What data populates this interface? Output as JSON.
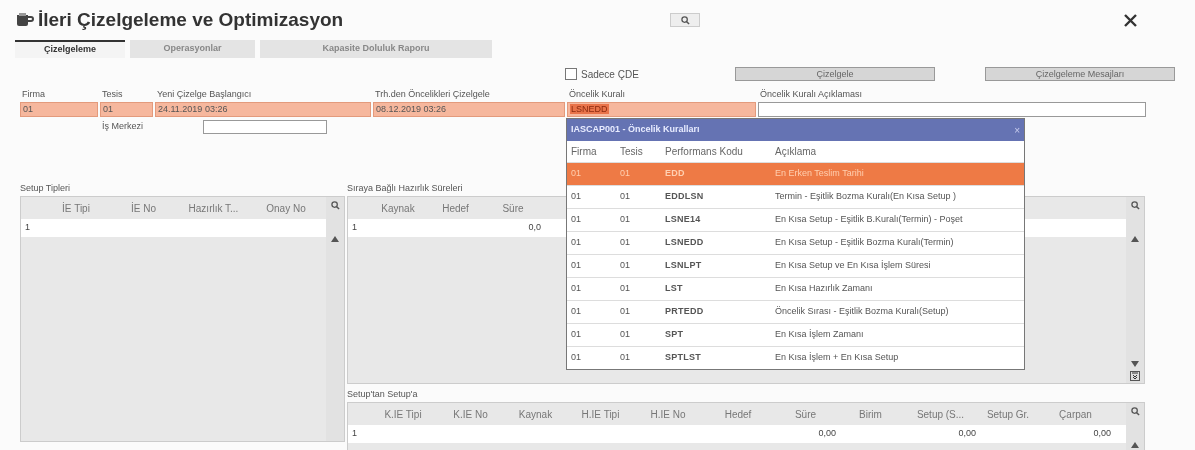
{
  "window": {
    "title": "İleri Çizelgeleme ve Optimizasyon"
  },
  "tabs": [
    {
      "label": "Çizelgeleme",
      "selected": true
    },
    {
      "label": "Operasyonlar",
      "selected": false
    },
    {
      "label": "Kapasite Doluluk Raporu",
      "selected": false
    }
  ],
  "only_cde": {
    "label": "Sadece ÇDE",
    "checked": false
  },
  "buttons": [
    "Çizelgele",
    "Çizelgeleme Mesajları"
  ],
  "header_fields": [
    {
      "label": "Firma",
      "value": "01",
      "highlighted": true
    },
    {
      "label": "Tesis",
      "value": "01",
      "highlighted": true
    },
    {
      "label": "Yeni Çizelge Başlangıcı",
      "value": "24.11.2019 03:26",
      "highlighted": true
    },
    {
      "label": "Trh.den Öncelikleri Çizelgele",
      "value": "08.12.2019 03:26",
      "highlighted": true
    },
    {
      "label": "Öncelik Kuralı",
      "value": "LSNEDD",
      "highlighted": true
    },
    {
      "label": "Öncelik Kuralı Açıklaması",
      "highlighted": false
    }
  ],
  "work_center": {
    "label": "İş Merkezi"
  },
  "setup_types": {
    "title": "Setup Tipleri",
    "columns": [
      "İE Tipi",
      "İE No",
      "Hazırlık T...",
      "Onay No"
    ],
    "rows": [
      {
        "number": "1",
        "cells": [
          null,
          null,
          null,
          null
        ]
      }
    ]
  },
  "sequence_times": {
    "title": "Sıraya Bağlı Hazırlık Süreleri",
    "columns": [
      "Kaynak",
      "Hedef",
      "Süre"
    ],
    "rows": [
      {
        "number": "1",
        "cells": [
          null,
          null,
          "0,0"
        ]
      }
    ]
  },
  "setup_to_setup": {
    "title": "Setup'tan Setup'a",
    "columns": [
      "K.IE Tipi",
      "K.IE No",
      "Kaynak",
      "H.IE Tipi",
      "H.IE No",
      "Hedef",
      "Süre",
      "Birim",
      "Setup (S...",
      "Setup Gr.",
      "Çarpan"
    ],
    "rows": [
      {
        "number": "1",
        "cells": [
          null,
          null,
          null,
          null,
          null,
          null,
          "0,00",
          null,
          "0,00",
          null,
          "0,00"
        ]
      }
    ]
  },
  "popup": {
    "title": "IASCAP001 - Öncelik Kuralları",
    "close": "×",
    "columns": [
      "Firma",
      "Tesis",
      "Performans Kodu",
      "Açıklama"
    ],
    "rows": [
      {
        "cells": [
          "01",
          "01",
          "EDD",
          "En Erken Teslim Tarihi"
        ],
        "selected": true
      },
      {
        "cells": [
          "01",
          "01",
          "EDDLSN",
          "Termin - Eşitlik Bozma Kuralı(En Kısa Setup )"
        ],
        "selected": false
      },
      {
        "cells": [
          "01",
          "01",
          "LSNE14",
          "En Kısa Setup - Eşitlik B.Kuralı(Termin) - Poşet"
        ],
        "selected": false
      },
      {
        "cells": [
          "01",
          "01",
          "LSNEDD",
          "En Kısa Setup - Eşitlik Bozma Kuralı(Termin)"
        ],
        "selected": false
      },
      {
        "cells": [
          "01",
          "01",
          "LSNLPT",
          "En Kısa Setup ve En Kısa İşlem Süresi"
        ],
        "selected": false
      },
      {
        "cells": [
          "01",
          "01",
          "LST",
          "En Kısa Hazırlık Zamanı"
        ],
        "selected": false
      },
      {
        "cells": [
          "01",
          "01",
          "PRTEDD",
          "Öncelik Sırası - Eşitlik Bozma Kuralı(Setup)"
        ],
        "selected": false
      },
      {
        "cells": [
          "01",
          "01",
          "SPT",
          "En Kısa İşlem Zamanı"
        ],
        "selected": false
      },
      {
        "cells": [
          "01",
          "01",
          "SPTLST",
          "En Kısa İşlem + En Kısa Setup"
        ],
        "selected": false
      }
    ]
  }
}
